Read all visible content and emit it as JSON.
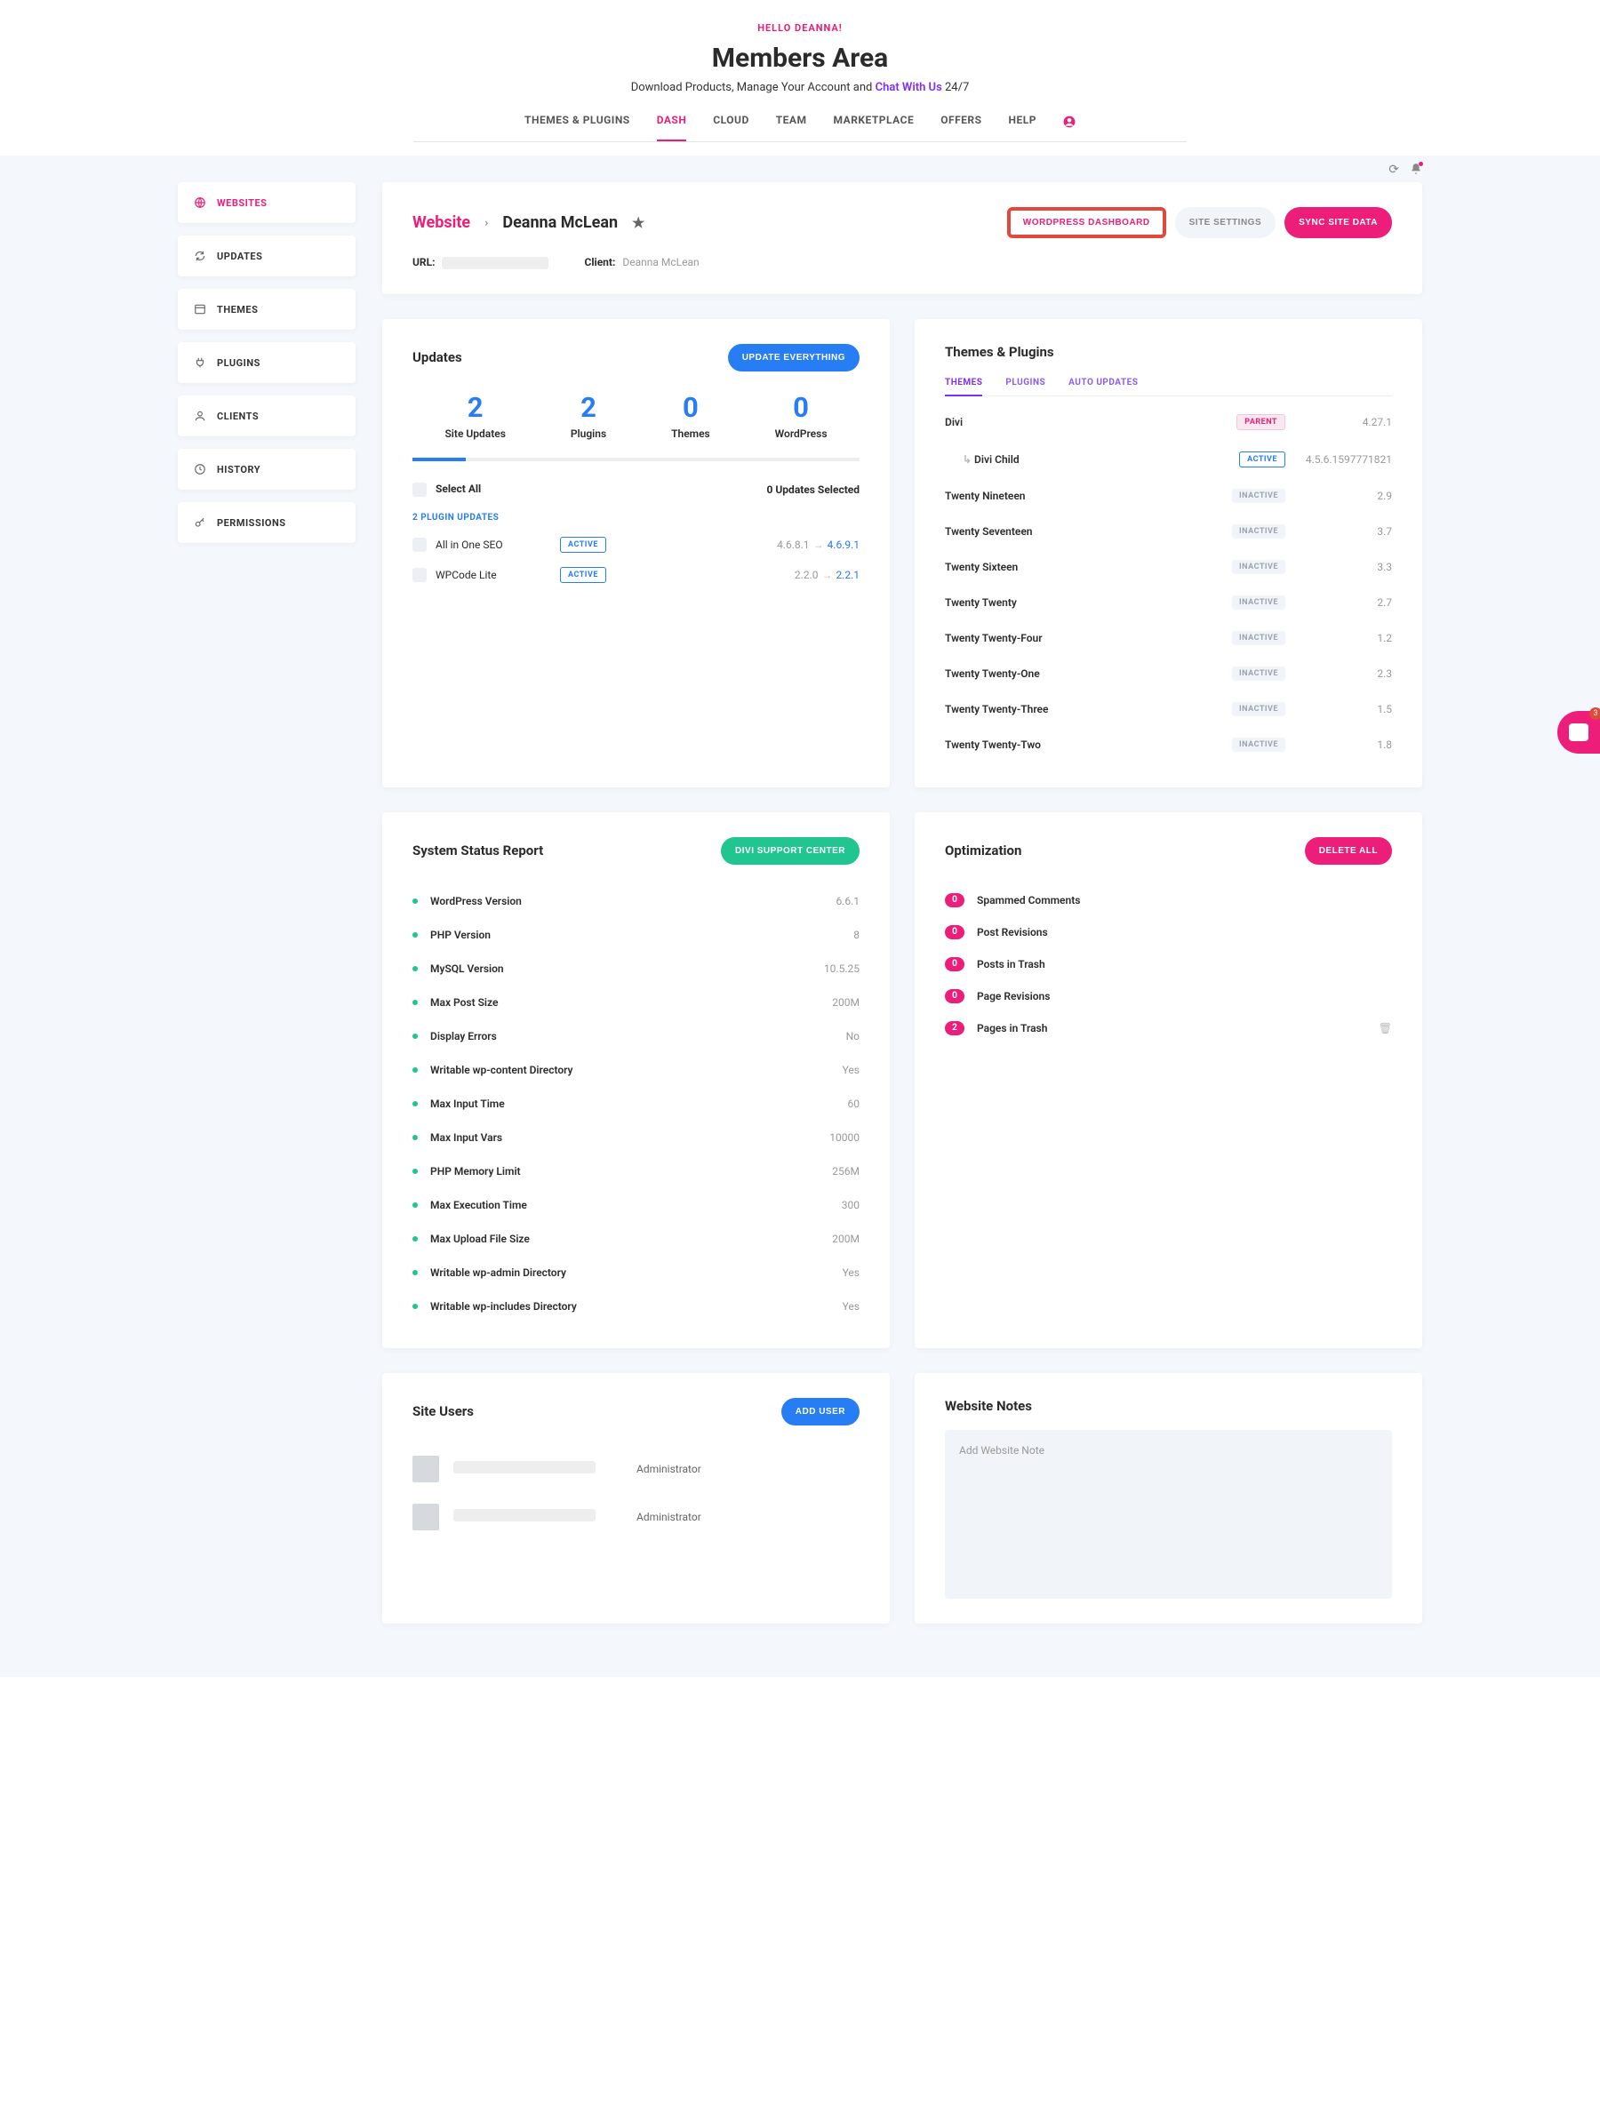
{
  "header": {
    "greeting": "HELLO DEANNA!",
    "title": "Members Area",
    "subtitle_pre": "Download Products, Manage Your Account and ",
    "chat_link": "Chat With Us",
    "subtitle_post": " 24/7"
  },
  "nav": {
    "items": [
      "THEMES & PLUGINS",
      "DASH",
      "CLOUD",
      "TEAM",
      "MARKETPLACE",
      "OFFERS",
      "HELP"
    ],
    "active": 1
  },
  "sidemenu": {
    "items": [
      {
        "label": "WEBSITES",
        "icon": "globe"
      },
      {
        "label": "UPDATES",
        "icon": "refresh"
      },
      {
        "label": "THEMES",
        "icon": "window"
      },
      {
        "label": "PLUGINS",
        "icon": "plug"
      },
      {
        "label": "CLIENTS",
        "icon": "person"
      },
      {
        "label": "HISTORY",
        "icon": "clock"
      },
      {
        "label": "PERMISSIONS",
        "icon": "key"
      }
    ],
    "active": 0
  },
  "hero": {
    "root": "Website",
    "name": "Deanna McLean",
    "buttons": {
      "wp_dash": "WORDPRESS DASHBOARD",
      "site_settings": "SITE SETTINGS",
      "sync": "SYNC SITE DATA"
    },
    "url_label": "URL:",
    "client_label": "Client:",
    "client_value": "Deanna McLean"
  },
  "updates": {
    "title": "Updates",
    "update_btn": "UPDATE EVERYTHING",
    "stats": [
      {
        "num": "2",
        "label": "Site Updates"
      },
      {
        "num": "2",
        "label": "Plugins"
      },
      {
        "num": "0",
        "label": "Themes"
      },
      {
        "num": "0",
        "label": "WordPress"
      }
    ],
    "select_all": "Select All",
    "selected_text": "0 Updates Selected",
    "sub_head": "2 PLUGIN UPDATES",
    "plugins": [
      {
        "name": "All in One SEO",
        "tag": "ACTIVE",
        "old": "4.6.8.1",
        "new": "4.6.9.1"
      },
      {
        "name": "WPCode Lite",
        "tag": "ACTIVE",
        "old": "2.2.0",
        "new": "2.2.1"
      }
    ]
  },
  "themes_plugins": {
    "title": "Themes & Plugins",
    "tabs": [
      "THEMES",
      "PLUGINS",
      "AUTO UPDATES"
    ],
    "rows": [
      {
        "name": "Divi",
        "tag": "PARENT",
        "ver": "4.27.1",
        "child": false
      },
      {
        "name": "Divi Child",
        "tag": "ACTIVE",
        "ver": "4.5.6.1597771821",
        "child": true
      },
      {
        "name": "Twenty Nineteen",
        "tag": "INACTIVE",
        "ver": "2.9",
        "child": false
      },
      {
        "name": "Twenty Seventeen",
        "tag": "INACTIVE",
        "ver": "3.7",
        "child": false
      },
      {
        "name": "Twenty Sixteen",
        "tag": "INACTIVE",
        "ver": "3.3",
        "child": false
      },
      {
        "name": "Twenty Twenty",
        "tag": "INACTIVE",
        "ver": "2.7",
        "child": false
      },
      {
        "name": "Twenty Twenty-Four",
        "tag": "INACTIVE",
        "ver": "1.2",
        "child": false
      },
      {
        "name": "Twenty Twenty-One",
        "tag": "INACTIVE",
        "ver": "2.3",
        "child": false
      },
      {
        "name": "Twenty Twenty-Three",
        "tag": "INACTIVE",
        "ver": "1.5",
        "child": false
      },
      {
        "name": "Twenty Twenty-Two",
        "tag": "INACTIVE",
        "ver": "1.8",
        "child": false
      }
    ]
  },
  "system_status": {
    "title": "System Status Report",
    "btn": "DIVI SUPPORT CENTER",
    "rows": [
      {
        "name": "WordPress Version",
        "val": "6.6.1"
      },
      {
        "name": "PHP Version",
        "val": "8"
      },
      {
        "name": "MySQL Version",
        "val": "10.5.25"
      },
      {
        "name": "Max Post Size",
        "val": "200M"
      },
      {
        "name": "Display Errors",
        "val": "No"
      },
      {
        "name": "Writable wp-content Directory",
        "val": "Yes"
      },
      {
        "name": "Max Input Time",
        "val": "60"
      },
      {
        "name": "Max Input Vars",
        "val": "10000"
      },
      {
        "name": "PHP Memory Limit",
        "val": "256M"
      },
      {
        "name": "Max Execution Time",
        "val": "300"
      },
      {
        "name": "Max Upload File Size",
        "val": "200M"
      },
      {
        "name": "Writable wp-admin Directory",
        "val": "Yes"
      },
      {
        "name": "Writable wp-includes Directory",
        "val": "Yes"
      }
    ]
  },
  "optimization": {
    "title": "Optimization",
    "btn": "DELETE ALL",
    "rows": [
      {
        "count": "0",
        "name": "Spammed Comments"
      },
      {
        "count": "0",
        "name": "Post Revisions"
      },
      {
        "count": "0",
        "name": "Posts in Trash"
      },
      {
        "count": "0",
        "name": "Page Revisions"
      },
      {
        "count": "2",
        "name": "Pages in Trash",
        "trash": true
      }
    ]
  },
  "site_users": {
    "title": "Site Users",
    "btn": "ADD USER",
    "rows": [
      {
        "role": "Administrator"
      },
      {
        "role": "Administrator"
      }
    ]
  },
  "notes": {
    "title": "Website Notes",
    "placeholder": "Add Website Note"
  },
  "intercom_count": "3"
}
